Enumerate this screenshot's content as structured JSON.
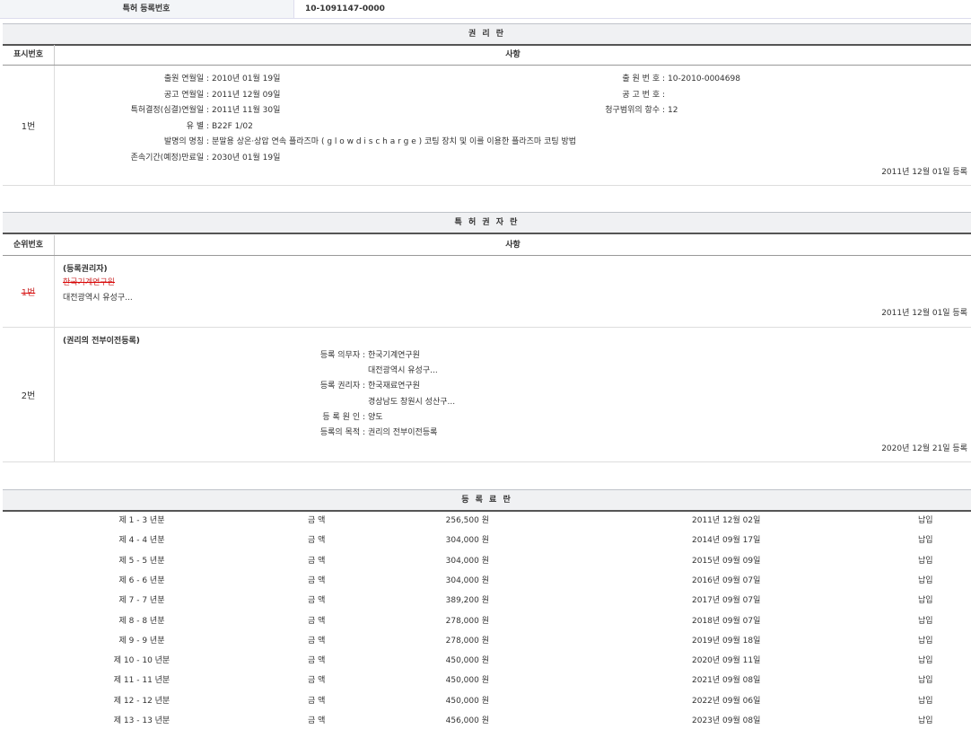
{
  "top": {
    "label": "특허 등록번호",
    "value": "10-1091147-0000"
  },
  "rights": {
    "title": "권 리 란",
    "col1": "표시번호",
    "col2": "사항",
    "row": {
      "num": "1번",
      "app_date_label": "출원 연월일 :",
      "app_date": "2010년 01월 19일",
      "app_no_label": "출 원 번 호 :",
      "app_no": "10-2010-0004698",
      "pub_date_label": "공고 연월일 :",
      "pub_date": "2011년 12월 09일",
      "pub_no_label": "공 고 번 호 :",
      "pub_no": "",
      "decision_label": "특허결정(심결)연월일 :",
      "decision": "2011년 11월 30일",
      "claims_label": "청구범위의 항수 :",
      "claims": "12",
      "class_label": "유 별 :",
      "class": "B22F 1/02",
      "title_label": "발명의 명칭 :",
      "invention": "분말용 상온·상압 연속 플라즈마 ( g l o w d i s c h a r g e ) 코팅 장치 및 이를 이용한 플라즈마 코팅 방법",
      "expiry_label": "존속기간(예정)만료일 :",
      "expiry": "2030년 01월 19일",
      "reg": "2011년 12월 01일 등록"
    }
  },
  "holders": {
    "title": "특 허 권 자 란",
    "col1": "순위번호",
    "col2": "사항",
    "row1": {
      "num": "1번",
      "type": "(등록권리자)",
      "name": "한국기계연구원",
      "addr": "대전광역시 유성구...",
      "reg": "2011년 12월 01일 등록"
    },
    "row2": {
      "num": "2번",
      "type": "(권리의 전부이전등록)",
      "obligor_label": "등록 의무자 :",
      "obligor": "한국기계연구원",
      "obligor_addr": "대전광역시 유성구...",
      "holder_label": "등록 권리자 :",
      "holder": "한국재료연구원",
      "holder_addr": "경상남도 창원시 성산구...",
      "cause_label": "등 록 원 인 :",
      "cause": "양도",
      "purpose_label": "등록의 목적 :",
      "purpose": "권리의 전부이전등록",
      "reg": "2020년 12월 21일 등록"
    }
  },
  "fees": {
    "title": "등 록 료 란",
    "amount_label": "금 액",
    "rows": [
      {
        "period": "제 1 - 3 년분",
        "amount": "256,500 원",
        "date": "2011년 12월 02일",
        "status": "납입"
      },
      {
        "period": "제 4 - 4 년분",
        "amount": "304,000 원",
        "date": "2014년 09월 17일",
        "status": "납입"
      },
      {
        "period": "제 5 - 5 년분",
        "amount": "304,000 원",
        "date": "2015년 09월 09일",
        "status": "납입"
      },
      {
        "period": "제 6 - 6 년분",
        "amount": "304,000 원",
        "date": "2016년 09월 07일",
        "status": "납입"
      },
      {
        "period": "제 7 - 7 년분",
        "amount": "389,200 원",
        "date": "2017년 09월 07일",
        "status": "납입"
      },
      {
        "period": "제 8 - 8 년분",
        "amount": "278,000 원",
        "date": "2018년 09월 07일",
        "status": "납입"
      },
      {
        "period": "제 9 - 9 년분",
        "amount": "278,000 원",
        "date": "2019년 09월 18일",
        "status": "납입"
      },
      {
        "period": "제 10 - 10 년분",
        "amount": "450,000 원",
        "date": "2020년 09월 11일",
        "status": "납입"
      },
      {
        "period": "제 11 - 11 년분",
        "amount": "450,000 원",
        "date": "2021년 09월 08일",
        "status": "납입"
      },
      {
        "period": "제 12 - 12 년분",
        "amount": "450,000 원",
        "date": "2022년 09월 06일",
        "status": "납입"
      },
      {
        "period": "제 13 - 13 년분",
        "amount": "456,000 원",
        "date": "2023년 09월 08일",
        "status": "납입"
      }
    ]
  }
}
